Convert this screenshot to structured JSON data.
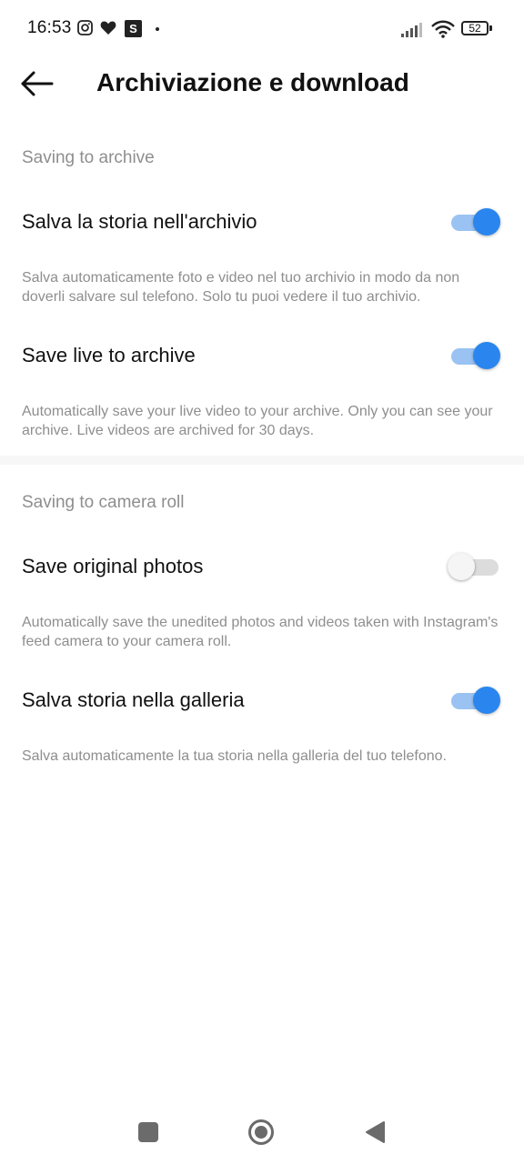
{
  "status_bar": {
    "time": "16:53",
    "battery": "52",
    "icons": [
      "instagram-icon",
      "heart-icon",
      "s-app-icon",
      "dot-icon",
      "signal-icon",
      "wifi-icon",
      "battery-icon"
    ],
    "s_letter": "S"
  },
  "header": {
    "title": "Archiviazione e download",
    "back_icon": "arrow-left-icon"
  },
  "sections": [
    {
      "title": "Saving to archive",
      "items": [
        {
          "label": "Salva la storia nell'archivio",
          "description": "Salva automaticamente foto e video nel tuo archivio in modo da non doverli salvare sul telefono. Solo tu puoi vedere il tuo archivio.",
          "enabled": true
        },
        {
          "label": "Save live to archive",
          "description": "Automatically save your live video to your archive. Only you can see your archive. Live videos are archived for 30 days.",
          "enabled": true
        }
      ]
    },
    {
      "title": "Saving to camera roll",
      "items": [
        {
          "label": "Save original photos",
          "description": "Automatically save the unedited photos and videos taken with Instagram's feed camera to your camera roll.",
          "enabled": false
        },
        {
          "label": "Salva storia nella galleria",
          "description": "Salva automaticamente la tua storia nella galleria del tuo telefono.",
          "enabled": true
        }
      ]
    }
  ],
  "colors": {
    "accent": "#2a86ee",
    "accent_track": "#9ac2f2",
    "secondary_text": "#8e8e8e"
  },
  "nav_bar": {
    "icons": [
      "recents-square-icon",
      "home-circle-icon",
      "back-triangle-icon"
    ]
  }
}
